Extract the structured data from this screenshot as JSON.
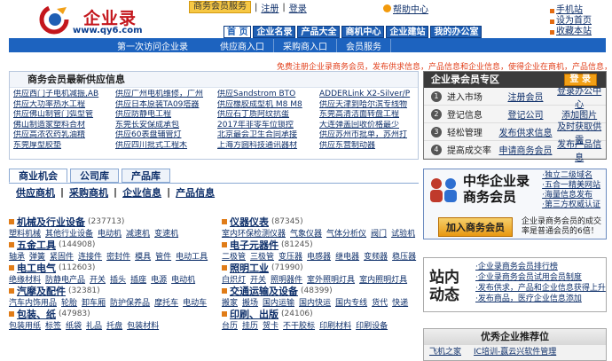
{
  "header": {
    "brand": "企业录",
    "url": "www.qy6.com",
    "service": "商务会员服务",
    "register": "注册",
    "login": "登录",
    "help": "帮助中心",
    "right_links": [
      "手机站",
      "设为首页",
      "收藏本站"
    ]
  },
  "nav": [
    "首 页",
    "企业名录",
    "产品大全",
    "商机中心",
    "企业建站",
    "我的办公室"
  ],
  "subnav": {
    "welcome": "第一次访问企业录",
    "items": [
      "供应商入口",
      "采购商入口",
      "会员服务"
    ]
  },
  "ticker": "免费注册企业录商务会员，发布供求信息，产品信息和企业信息，使得企业在商机，产品信息，获得实时发布",
  "supply": {
    "title": "商务会员最新供应信息",
    "items": [
      [
        "供应西门子电机减振,AB",
        "供应广州电机维修，广州",
        "供应Sandstrom BTO",
        "ADDERLink X2-Silver/P"
      ],
      [
        "供应大功率热水工程",
        "供应日本原装TA09塔器",
        "供应橡胶成型机 M8 M8",
        "供应天津到哈尔滨专线物"
      ],
      [
        "供应佛山制管门弧型管",
        "供应防静电工程",
        "供应石丁质阿纹抗蛋",
        "东莞高清洁面转盘工程"
      ],
      [
        "佛山制造家塑料合材",
        "东莞长安保成承包",
        "2017年非零车位锁控",
        "大连弹盖回收价格最少"
      ],
      [
        "供应高浓农药乳油精",
        "供应60表盘辅管灯",
        "北京最会卫生合同承接",
        "供应苏州市批单，苏州打"
      ],
      [
        "东莞厚型胶垫",
        "供应四川批式工程木",
        "上海方圆科技通讯器材",
        "供应东营制动器"
      ]
    ]
  },
  "zone": {
    "title": "企业录会员专区",
    "login": "登 录",
    "rows": [
      {
        "n": "1",
        "label": "进入市场",
        "a": "注册会员",
        "b": "登录办公中心"
      },
      {
        "n": "2",
        "label": "登记信息",
        "a": "登记公司",
        "b": "添加图片"
      },
      {
        "n": "3",
        "label": "轻松管理",
        "a": "发布供求信息",
        "b": "及时获取供需"
      },
      {
        "n": "4",
        "label": "提高成交率",
        "a": "申请商务会员",
        "b": "发布产品信息"
      }
    ]
  },
  "tabs": {
    "main": [
      "商业机会",
      "公司库",
      "产品库"
    ],
    "sub": [
      "供应商机",
      "采购商机",
      "企业信息",
      "产品信息"
    ]
  },
  "categories": [
    {
      "title": "机械及行业设备",
      "count": "(237713)",
      "items": [
        "塑料机械",
        "其他行业设备",
        "电动机",
        "减速机",
        "变速机"
      ]
    },
    {
      "title": "仪器仪表",
      "count": "(87345)",
      "items": [
        "室内环保检测仪器",
        "气象仪器",
        "气体分析仪",
        "阀门",
        "试验机"
      ]
    },
    {
      "title": "五金工具",
      "count": "(144908)",
      "items": [
        "轴承",
        "弹簧",
        "紧固件",
        "连接件",
        "密封件",
        "模具",
        "管件",
        "电动工具"
      ]
    },
    {
      "title": "电子元器件",
      "count": "(81245)",
      "items": [
        "二极管",
        "三极管",
        "变压器",
        "电感器",
        "继电器",
        "变频器",
        "稳压器"
      ]
    },
    {
      "title": "电工电气",
      "count": "(112603)",
      "items": [
        "绝缘材料",
        "防静电产品",
        "开关",
        "插头",
        "插座",
        "电源",
        "电动机"
      ]
    },
    {
      "title": "照明工业",
      "count": "(71990)",
      "items": [
        "白炽灯",
        "开关",
        "照明器件",
        "室外照明灯具",
        "室内照明灯具"
      ]
    },
    {
      "title": "汽摩及配件",
      "count": "(32381)",
      "items": [
        "汽车内饰用品",
        "轮胎",
        "卸车厢",
        "防护保养品",
        "摩托车",
        "电动车"
      ]
    },
    {
      "title": "交通运输及设备",
      "count": "(48399)",
      "items": [
        "搬家",
        "搬场",
        "国内运输",
        "国内快运",
        "国内专线",
        "货代",
        "快递"
      ]
    },
    {
      "title": "包装、纸",
      "count": "(47983)",
      "items": [
        "包装用纸",
        "标签",
        "纸袋",
        "礼品",
        "托盘",
        "包装材料"
      ]
    },
    {
      "title": "印刷、出版",
      "count": "(24106)",
      "items": [
        "台历",
        "挂历",
        "贺卡",
        "不干胶标",
        "印刷材料",
        "印刷设备"
      ]
    }
  ],
  "promo": {
    "title_line1": "中华企业录",
    "title_line2": "商务会员",
    "q": [
      "·独立二级域名",
      "·五合一精美网站",
      "·海量信息发布",
      "·第三方权威认证"
    ],
    "join": "加入商务会员",
    "desc": "企业录商务会员的成交率是普通会员的6倍！"
  },
  "news": {
    "big_line1": "站内",
    "big_line2": "动态",
    "items": [
      "·企业录商务会员排行榜",
      "·企业录商务会员试用会员制度",
      "·发布供求，产品和企业信息获得上升",
      "·发布商品，医疗企业信息添加"
    ]
  },
  "rec": {
    "title": "优秀企业推荐位",
    "items": [
      "飞机之家",
      "IC培训-赢云兴软件管理"
    ]
  }
}
